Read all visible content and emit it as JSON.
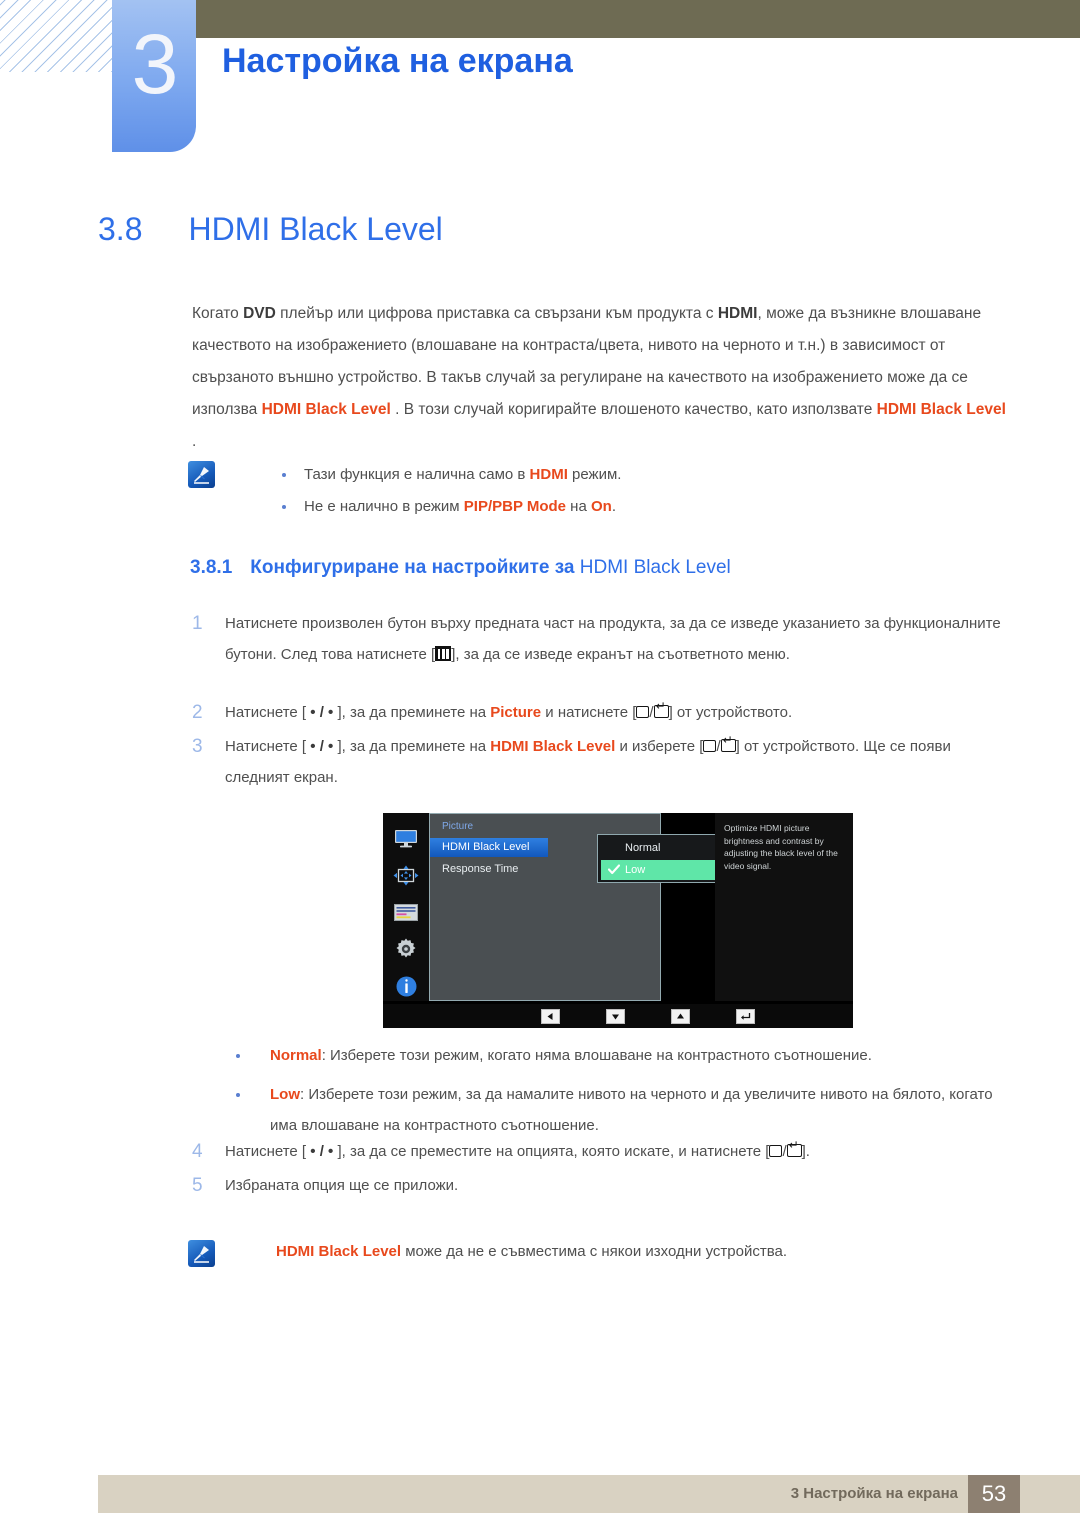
{
  "header": {
    "chapter_number": "3",
    "chapter_title": "Настройка на екрана"
  },
  "section": {
    "number": "3.8",
    "title": "HDMI Black Level"
  },
  "intro": {
    "part1": "Когато ",
    "dvd": "DVD",
    "part2": " плейър или цифрова приставка са свързани към продукта с ",
    "hdmi": "HDMI",
    "part3": ", може да възникне влошаване качеството на изображението (влошаване на контраста/цвета, нивото на черното и т.н.) в зависимост от свързаното външно устройство. В такъв случай за регулиране на качеството на изображението може да се използва ",
    "kw1": "HDMI Black Level",
    "part4": " . В този случай коригирайте влошеното качество, като използвате ",
    "kw2": "HDMI Black Level",
    "part5": " ."
  },
  "note_top": {
    "icon": "note-pencil-icon",
    "bullets": [
      {
        "before": "Тази функция е налична само в ",
        "kw": "HDMI",
        "after": " режим."
      },
      {
        "before": "Не е налично в режим ",
        "kw": "PIP/PBP Mode",
        "mid": " на ",
        "kw2": "On",
        "after": "."
      }
    ]
  },
  "subsection": {
    "number": "3.8.1",
    "title": "Конфигуриране на настройките за ",
    "keyword": "HDMI Black Level"
  },
  "steps": [
    {
      "number": "1",
      "text_a": "Натиснете произволен бутон върху предната част на продукта, за да се изведе указанието за функционалните бутони. След това натиснете [",
      "icon": "menu-key-icon",
      "text_b": "], за да се изведе екранът на съответното меню."
    },
    {
      "number": "2",
      "text_a": "Натиснете [ ",
      "dots": "• / •",
      "text_b": " ], за да преминете на ",
      "kw": "Picture",
      "text_c": " и натиснете [",
      "icon_a": "source-key-icon",
      "slash": "/",
      "icon_b": "enter-key-icon",
      "text_d": "] от устройството."
    },
    {
      "number": "3",
      "text_a": "Натиснете [ ",
      "dots": "• / •",
      "text_b": " ], за да преминете на ",
      "kw": "HDMI Black Level",
      "text_c": " и изберете [",
      "icon_a": "source-key-icon",
      "slash": "/",
      "icon_b": "enter-key-icon",
      "text_d": "] от устройството. Ще се появи следният екран."
    },
    {
      "number": "4",
      "text_a": "Натиснете [ ",
      "dots": "• / •",
      "text_b": " ], за да се преместите на опцията, която искате, и натиснете [",
      "icon_a": "source-key-icon",
      "slash": "/",
      "icon_b": "enter-key-icon",
      "text_d": "]."
    },
    {
      "number": "5",
      "text_a": "Избраната опция ще се приложи."
    }
  ],
  "osd": {
    "rail_icons": [
      "monitor-icon",
      "pip-arrows-icon",
      "osd-list-icon",
      "gear-icon",
      "info-icon"
    ],
    "category": "Picture",
    "menu_items": [
      {
        "label": "HDMI Black Level",
        "selected": true
      },
      {
        "label": "Response Time",
        "selected": false
      }
    ],
    "options": [
      {
        "label": "Normal",
        "checked": false
      },
      {
        "label": "Low",
        "checked": true
      }
    ],
    "help_text": "Optimize HDMI picture brightness and contrast by adjusting the black level of the video signal.",
    "buttons": [
      "left-arrow-icon",
      "down-arrow-icon",
      "up-arrow-icon",
      "enter-icon"
    ],
    "colors": {
      "selected_row": "#1258bd",
      "checked_option": "#5fe6a8",
      "panel_bg": "#4a4f52",
      "help_bg": "#101010"
    }
  },
  "option_descriptions": [
    {
      "kw": "Normal",
      "text": ": Изберете този режим, когато няма влошаване на контрастното съотношение."
    },
    {
      "kw": "Low",
      "text": ": Изберете този режим, за да намалите нивото на черното и да увеличите нивото на бялото, когато има влошаване на контрастното съотношение."
    }
  ],
  "note_bottom": {
    "icon": "note-pencil-icon",
    "kw": "HDMI Black Level",
    "text": " може да не е съвместима с някои изходни устройства."
  },
  "footer": {
    "text": "3 Настройка на екрана",
    "page": "53"
  }
}
